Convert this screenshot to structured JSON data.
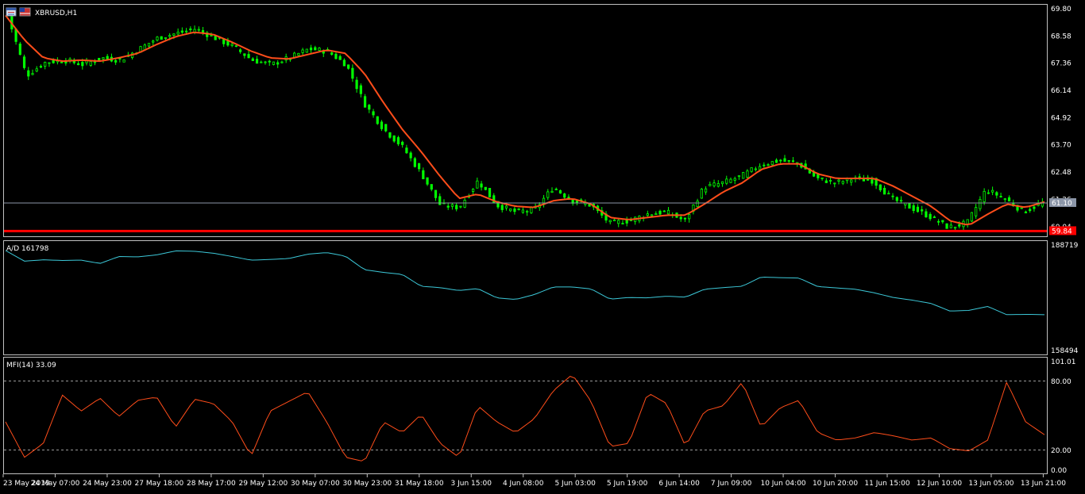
{
  "colors": {
    "background": "#000000",
    "frame": "#c0c0c0",
    "candle": "#00ff00",
    "moving_average": "#ff4d1a",
    "ad_line": "#3cc8d8",
    "mfi_line": "#ff4d1a",
    "bid_line": "#8c96a8",
    "low_line": "#ff0000",
    "low_badge": "#ff0000",
    "bid_badge": "#8c96a8",
    "level_line": "#9a9a9a",
    "text": "#ffffff"
  },
  "price_panel": {
    "title": "XBRUSD,H1",
    "icons": [
      "chart-window-icon",
      "flag-icon"
    ],
    "current_price_label": "61.10",
    "low_price_label": "59.84"
  },
  "ad_panel": {
    "title": "A/D 161798",
    "scale_top": "188719",
    "scale_bottom": "158494"
  },
  "mfi_panel": {
    "title": "MFI(14) 33.09",
    "scale_labels": [
      "101.01",
      "80.00",
      "20.00",
      "0.00"
    ]
  },
  "chart_data": [
    {
      "type": "candlestick",
      "symbol": "XBRUSD",
      "timeframe": "H1",
      "y_tick_labels": [
        "69.80",
        "68.58",
        "67.36",
        "66.14",
        "64.92",
        "63.70",
        "62.48",
        "61.26",
        "60.04"
      ],
      "ylim": [
        59.5,
        69.8
      ],
      "x_tick_labels": [
        "23 May 2019",
        "24 May 07:00",
        "24 May 23:00",
        "27 May 18:00",
        "28 May 17:00",
        "29 May 12:00",
        "30 May 07:00",
        "30 May 23:00",
        "31 May 18:00",
        "3 Jun 15:00",
        "4 Jun 08:00",
        "5 Jun 03:00",
        "5 Jun 19:00",
        "6 Jun 14:00",
        "7 Jun 09:00",
        "10 Jun 04:00",
        "10 Jun 20:00",
        "11 Jun 15:00",
        "12 Jun 10:00",
        "13 Jun 05:00",
        "13 Jun 21:00"
      ],
      "current_price": 61.1,
      "low_line_price": 59.84,
      "moving_average_anchors": [
        69.5,
        68.4,
        67.6,
        67.45,
        67.5,
        67.45,
        67.6,
        67.8,
        68.2,
        68.55,
        68.75,
        68.65,
        68.3,
        67.9,
        67.6,
        67.55,
        67.75,
        67.95,
        67.8,
        66.9,
        65.6,
        64.4,
        63.4,
        62.3,
        61.3,
        61.5,
        61.15,
        60.95,
        60.9,
        61.2,
        61.3,
        61.05,
        60.45,
        60.35,
        60.45,
        60.55,
        60.55,
        61.05,
        61.6,
        62.0,
        62.6,
        62.85,
        62.85,
        62.4,
        62.2,
        62.2,
        62.2,
        61.85,
        61.4,
        60.95,
        60.3,
        60.1,
        60.6,
        61.05,
        60.9,
        61.15
      ],
      "close_anchors": [
        69.5,
        66.8,
        67.4,
        67.5,
        67.3,
        67.6,
        67.5,
        68.0,
        68.5,
        68.7,
        68.9,
        68.5,
        68.1,
        67.5,
        67.3,
        67.6,
        68.0,
        67.9,
        67.3,
        65.5,
        64.4,
        63.6,
        62.4,
        61.0,
        60.9,
        62.1,
        61.0,
        60.7,
        60.8,
        61.8,
        61.2,
        61.0,
        60.2,
        60.3,
        60.6,
        60.7,
        60.3,
        61.8,
        62.0,
        62.3,
        62.8,
        63.0,
        62.9,
        62.2,
        62.0,
        62.2,
        62.1,
        61.3,
        60.9,
        60.5,
        60.0,
        60.2,
        61.7,
        61.3,
        60.7,
        61.1
      ]
    },
    {
      "type": "line",
      "name": "A/D",
      "last_value": 161798,
      "ylim": [
        158494,
        188719
      ],
      "values": [
        186800,
        183600,
        184000,
        183800,
        183900,
        182900,
        185000,
        184900,
        185500,
        186700,
        186600,
        186000,
        185000,
        183900,
        184100,
        184400,
        185700,
        186200,
        185100,
        181000,
        180200,
        179600,
        176000,
        175600,
        174700,
        175300,
        172500,
        172000,
        173500,
        175800,
        175800,
        175200,
        172100,
        172600,
        172500,
        173000,
        172700,
        175100,
        175600,
        176000,
        178800,
        178600,
        178500,
        175900,
        175500,
        175100,
        174000,
        172600,
        171800,
        170800,
        168500,
        168700,
        169900,
        167400,
        167500,
        167400
      ]
    },
    {
      "type": "line",
      "name": "MFI(14)",
      "last_value": 33.09,
      "ylim": [
        0,
        101.01
      ],
      "levels": [
        80,
        20
      ],
      "values": [
        45,
        12,
        25,
        70,
        55,
        67,
        50,
        65,
        68,
        40,
        66,
        62,
        45,
        13,
        55,
        64,
        73,
        45,
        12,
        8,
        45,
        35,
        52,
        25,
        12,
        60,
        45,
        35,
        48,
        74,
        89,
        64,
        22,
        25,
        72,
        62,
        22,
        55,
        60,
        82,
        40,
        58,
        65,
        35,
        28,
        30,
        35,
        32,
        28,
        30,
        20,
        18,
        28,
        82,
        45,
        33
      ]
    }
  ]
}
